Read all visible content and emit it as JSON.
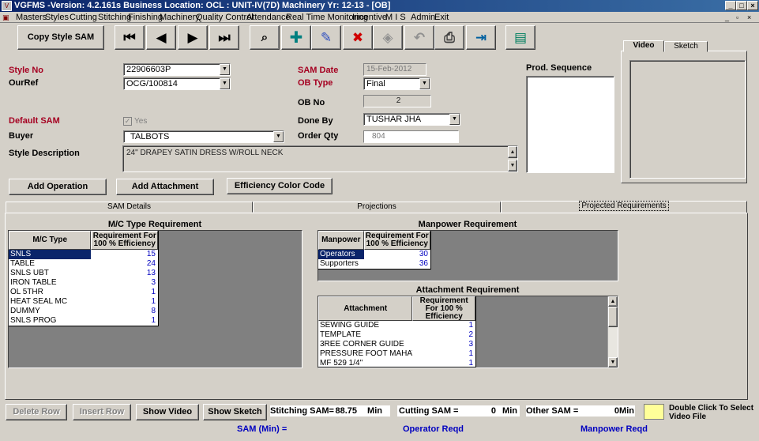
{
  "window": {
    "title": "VGFMS -Version: 4.2.161s Business Location: OCL : UNIT-IV(7D)  Machinery Yr: 12-13  - [OB]",
    "app_icon": "app-icon"
  },
  "menu": [
    "Masters",
    "Styles",
    "Cutting",
    "Stitching",
    "Finishing",
    "Machinery",
    "Quality Control",
    "Attendance",
    "Real Time Monitoring",
    "Incentive",
    "M I S",
    "Admin",
    "Exit"
  ],
  "toolbar": {
    "copy_label": "Copy Style SAM",
    "icons": [
      "first-record-icon",
      "previous-record-icon",
      "next-record-icon",
      "last-record-icon",
      "binoculars-icon",
      "add-icon",
      "edit-icon",
      "delete-icon",
      "save-icon",
      "undo-icon",
      "print-icon",
      "exit-icon",
      "notes-icon"
    ]
  },
  "form": {
    "style_no_label": "Style No",
    "style_no": "22906603P",
    "ourref_label": "OurRef",
    "ourref": "OCG/100814",
    "default_sam_label": "Default SAM",
    "default_sam_value": "Yes",
    "buyer_label": "Buyer",
    "buyer": "TALBOTS",
    "style_desc_label": "Style Description",
    "style_desc": "24\" DRAPEY SATIN DRESS W/ROLL NECK",
    "sam_date_label": "SAM Date",
    "sam_date": "15-Feb-2012",
    "ob_type_label": "OB Type",
    "ob_type": "Final",
    "ob_no_label": "OB No",
    "ob_no": "2",
    "done_by_label": "Done By",
    "done_by": "TUSHAR JHA",
    "order_qty_label": "Order Qty",
    "order_qty": "804",
    "prod_seq_label": "Prod. Sequence"
  },
  "media_tabs": [
    "Video",
    "Sketch"
  ],
  "actions": {
    "add_operation": "Add Operation",
    "add_attachment": "Add Attachment",
    "efficiency": "Efficiency Color Code"
  },
  "tabs": [
    "SAM Details",
    "Projections",
    "Projected Requirements"
  ],
  "mc": {
    "title": "M/C Type Requirement",
    "col1": "M/C Type",
    "col2": "Requirement For 100 % Efficiency",
    "rows": [
      {
        "name": "SNLS",
        "value": "15"
      },
      {
        "name": "TABLE",
        "value": "24"
      },
      {
        "name": "SNLS UBT",
        "value": "13"
      },
      {
        "name": "IRON TABLE",
        "value": "3"
      },
      {
        "name": "OL 5THR",
        "value": "1"
      },
      {
        "name": "HEAT SEAL MC",
        "value": "1"
      },
      {
        "name": "DUMMY",
        "value": "8"
      },
      {
        "name": "SNLS PROG",
        "value": "1"
      }
    ]
  },
  "manpower": {
    "title": "Manpower Requirement",
    "col1": "Manpower",
    "col2": "Requirement For 100 % Efficiency",
    "rows": [
      {
        "name": "Operators",
        "value": "30"
      },
      {
        "name": "Supporters",
        "value": "36"
      }
    ]
  },
  "attachment": {
    "title": "Attachment Requirement",
    "col1": "Attachment",
    "col2": "Requirement For 100 % Efficiency",
    "rows": [
      {
        "name": "SEWING GUIDE",
        "value": "1"
      },
      {
        "name": "TEMPLATE",
        "value": "2"
      },
      {
        "name": "3REE CORNER GUIDE",
        "value": "3"
      },
      {
        "name": "PRESSURE FOOT MAHAVEER",
        "value": "1"
      },
      {
        "name": "MF 529 1/4\"",
        "value": "1"
      }
    ]
  },
  "bottom": {
    "delete_row": "Delete Row",
    "insert_row": "Insert Row",
    "show_video": "Show Video",
    "show_sketch": "Show Sketch",
    "stitching_label": "Stitching SAM=",
    "stitching_value": "88.75",
    "stitching_unit": "Min",
    "cutting_label": "Cutting SAM =",
    "cutting_value": "0",
    "cutting_unit": "Min",
    "other_label": "Other SAM =",
    "other_value": "0",
    "other_unit": "Min",
    "double_click": "Double Click To Select Video File",
    "sam_min": "SAM (Min) =",
    "operator_reqd": "Operator Reqd",
    "manpower_reqd": "Manpower Reqd",
    "color_swatch": "#ffff99"
  }
}
